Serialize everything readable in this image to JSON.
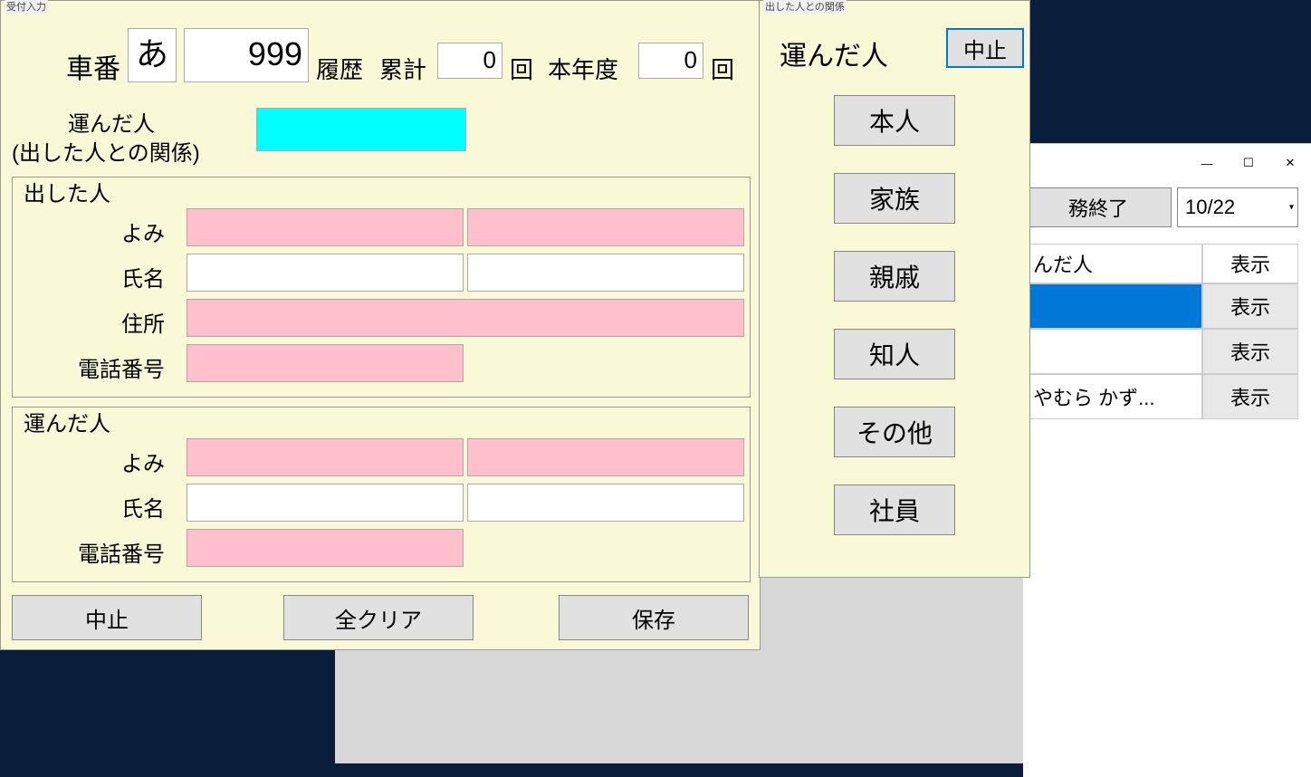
{
  "mainWin": {
    "title": "受付入力",
    "carLabel": "車番",
    "carKana": "あ",
    "carNum": "999",
    "histLabel": "履歴",
    "sumLabel": "累計",
    "sumVal": "0",
    "timesLabel": "回",
    "yearLabel": "本年度",
    "yearVal": "0",
    "timesLabel2": "回",
    "bringerLabel1": "運んだ人",
    "bringerLabel2": "(出した人との関係)",
    "bringerVal": "",
    "groups": {
      "sender": {
        "title": "出した人",
        "yomi": "よみ",
        "name": "氏名",
        "addr": "住所",
        "tel": "電話番号"
      },
      "bringer": {
        "title": "運んだ人",
        "yomi": "よみ",
        "name": "氏名",
        "tel": "電話番号"
      }
    },
    "buttons": {
      "cancel": "中止",
      "clear": "全クリア",
      "save": "保存"
    }
  },
  "relWin": {
    "title": "出した人との関係",
    "heading": "運んだ人",
    "cancel": "中止",
    "options": [
      "本人",
      "家族",
      "親戚",
      "知人",
      "その他",
      "社員"
    ]
  },
  "bgWin": {
    "endWork": "務終了",
    "date": "10/22",
    "colBringer": "んだ人",
    "colShow": "表示",
    "rows": [
      {
        "text": "",
        "btn": "表示",
        "selected": true
      },
      {
        "text": "",
        "btn": "表示",
        "selected": false
      },
      {
        "text": "やむら かず...",
        "btn": "表示",
        "selected": false
      }
    ]
  }
}
